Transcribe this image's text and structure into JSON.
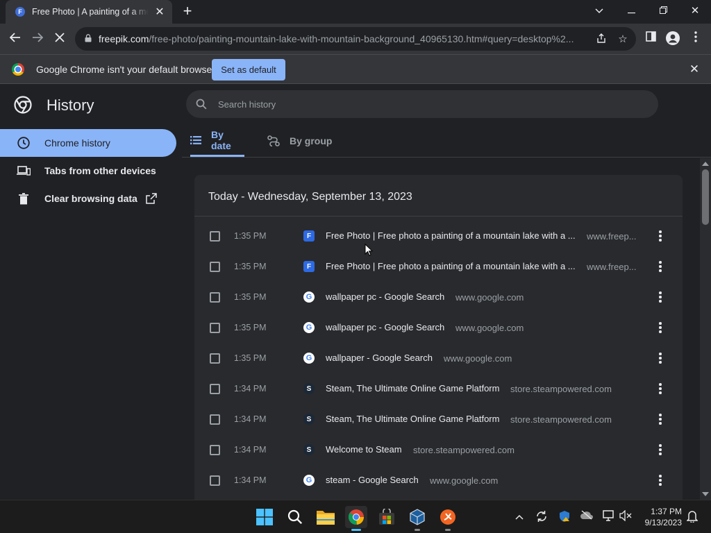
{
  "window": {
    "tab_title": "Free Photo | A painting of a mountain lake with a mountain background",
    "url_host": "freepik.com",
    "url_path": "/free-photo/painting-mountain-lake-with-mountain-background_40965130.htm#query=desktop%2..."
  },
  "infobar": {
    "message": "Google Chrome isn't your default browser",
    "button_label": "Set as default"
  },
  "header": {
    "title": "History",
    "search_placeholder": "Search history"
  },
  "sidebar": {
    "items": [
      {
        "label": "Chrome history",
        "icon": "clock-icon",
        "active": true
      },
      {
        "label": "Tabs from other devices",
        "icon": "devices-icon",
        "active": false
      },
      {
        "label": "Clear browsing data",
        "icon": "trash-icon",
        "active": false
      }
    ]
  },
  "tabs": [
    {
      "label": "By date",
      "icon": "list-icon",
      "active": true
    },
    {
      "label": "By group",
      "icon": "group-icon",
      "active": false
    }
  ],
  "history": {
    "date_heading": "Today - Wednesday, September 13, 2023",
    "entries": [
      {
        "time": "1:35 PM",
        "title": "Free Photo | Free photo a painting of a mountain lake with a ...",
        "domain": "www.freep...",
        "favicon": "freepik"
      },
      {
        "time": "1:35 PM",
        "title": "Free Photo | Free photo a painting of a mountain lake with a ...",
        "domain": "www.freep...",
        "favicon": "freepik"
      },
      {
        "time": "1:35 PM",
        "title": "wallpaper pc - Google Search",
        "domain": "www.google.com",
        "favicon": "google"
      },
      {
        "time": "1:35 PM",
        "title": "wallpaper pc - Google Search",
        "domain": "www.google.com",
        "favicon": "google"
      },
      {
        "time": "1:35 PM",
        "title": "wallpaper - Google Search",
        "domain": "www.google.com",
        "favicon": "google"
      },
      {
        "time": "1:34 PM",
        "title": "Steam, The Ultimate Online Game Platform",
        "domain": "store.steampowered.com",
        "favicon": "steam"
      },
      {
        "time": "1:34 PM",
        "title": "Steam, The Ultimate Online Game Platform",
        "domain": "store.steampowered.com",
        "favicon": "steam"
      },
      {
        "time": "1:34 PM",
        "title": "Welcome to Steam",
        "domain": "store.steampowered.com",
        "favicon": "steam"
      },
      {
        "time": "1:34 PM",
        "title": "steam - Google Search",
        "domain": "www.google.com",
        "favicon": "google"
      }
    ]
  },
  "taskbar": {
    "time": "1:37 PM",
    "date": "9/13/2023",
    "apps": [
      "windows-start-icon",
      "search-icon",
      "file-explorer-icon",
      "chrome-icon",
      "microsoft-store-icon",
      "virtualbox-icon",
      "app-icon"
    ]
  },
  "colors": {
    "accent": "#8ab4f8",
    "background": "#202124",
    "card": "#292a2d"
  }
}
